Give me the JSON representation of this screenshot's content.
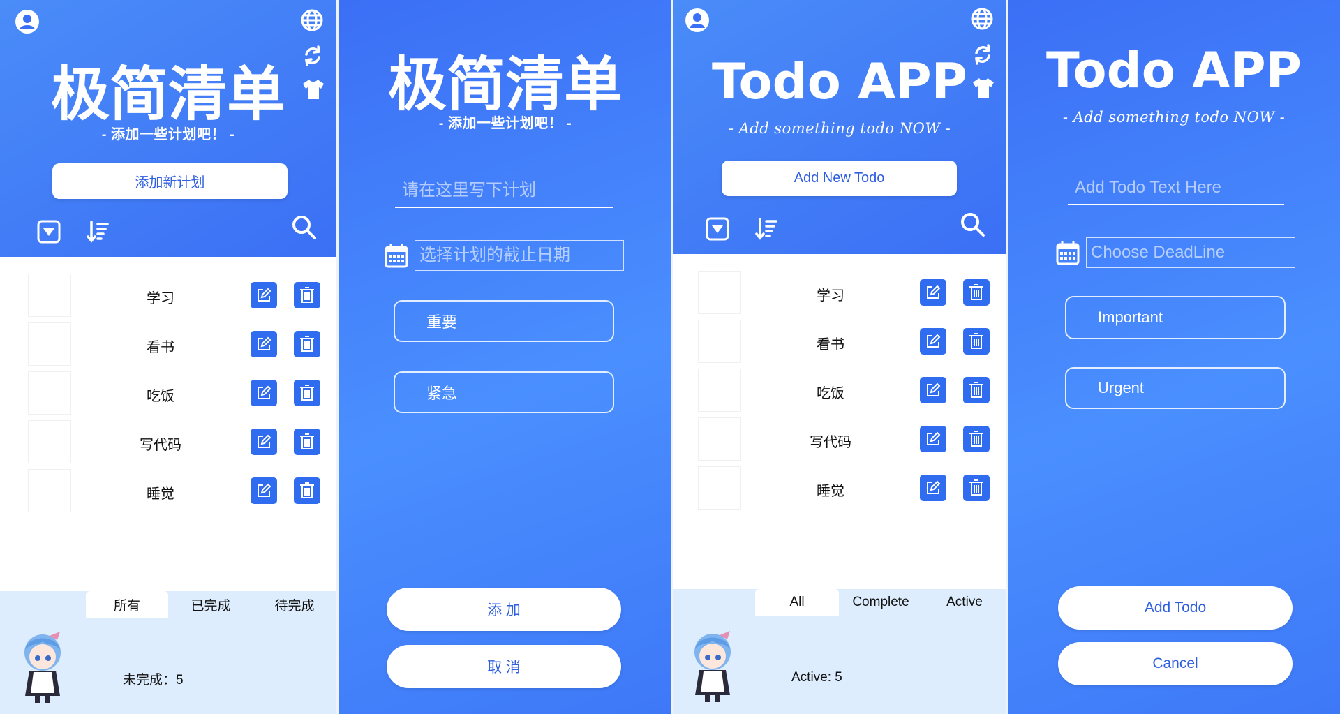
{
  "panels": [
    {
      "title": "极简清单",
      "subtitle": "- 添加一些计划吧！ -",
      "add_button": "添加新计划",
      "todos": [
        "学习",
        "看书",
        "吃饭",
        "写代码",
        "睡觉"
      ],
      "tabs": [
        "所有",
        "已完成",
        "待完成"
      ],
      "active_tab": 0,
      "count_label": "未完成：5"
    },
    {
      "title": "极简清单",
      "subtitle": "- 添加一些计划吧！ -",
      "text_placeholder": "请在这里写下计划",
      "date_placeholder": "选择计划的截止日期",
      "option_important": "重要",
      "option_urgent": "紧急",
      "submit_button": "添 加",
      "cancel_button": "取 消"
    },
    {
      "title": "Todo APP",
      "subtitle": "- Add something todo NOW -",
      "add_button": "Add New Todo",
      "todos": [
        "学习",
        "看书",
        "吃饭",
        "写代码",
        "睡觉"
      ],
      "tabs": [
        "All",
        "Complete",
        "Active"
      ],
      "active_tab": 0,
      "count_label": "Active: 5"
    },
    {
      "title": "Todo APP",
      "subtitle": "- Add something todo NOW -",
      "text_placeholder": "Add Todo Text Here",
      "date_placeholder": "Choose DeadLine",
      "option_important": "Important",
      "option_urgent": "Urgent",
      "submit_button": "Add Todo",
      "cancel_button": "Cancel"
    }
  ],
  "icons": {
    "user": "user-circle-icon",
    "language": "globe-icon",
    "refresh": "refresh-icon",
    "theme": "tshirt-icon",
    "filter": "dropdown-filter-icon",
    "sort": "sort-icon",
    "search": "search-icon",
    "edit": "edit-icon",
    "delete": "trash-icon",
    "calendar": "calendar-icon"
  },
  "colors": {
    "primary": "#2f6cf0",
    "header_start": "#4a8cf8",
    "header_end": "#3b6ff5",
    "footer": "#ddedfd"
  }
}
